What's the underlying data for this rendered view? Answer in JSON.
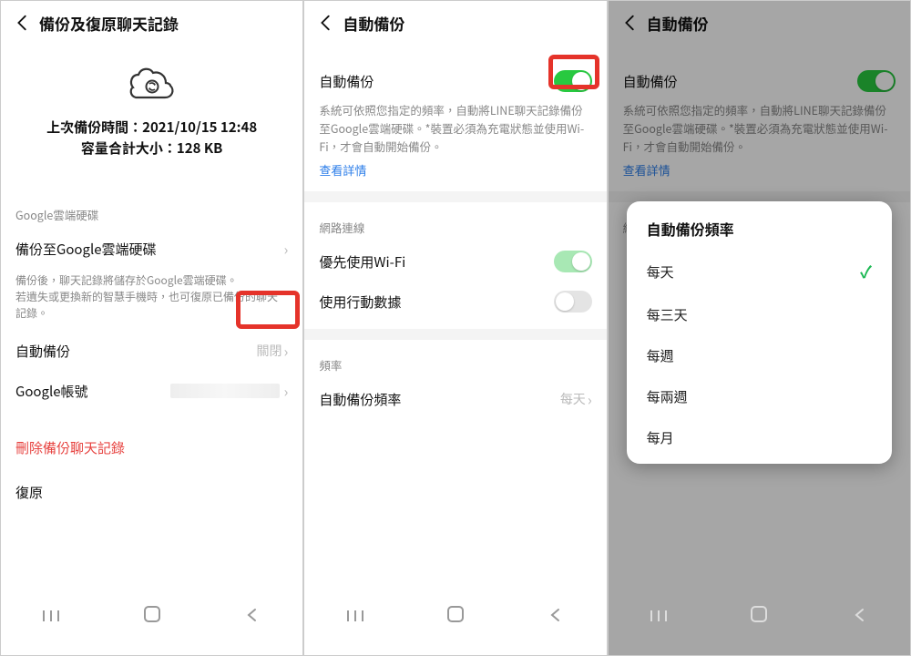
{
  "panel1": {
    "title": "備份及復原聊天記錄",
    "last_backup_label": "上次備份時間：2021/10/15 12:48",
    "size_label": "容量合計大小：128 KB",
    "cloud_section": "Google雲端硬碟",
    "backup_to_google": "備份至Google雲端硬碟",
    "backup_desc1": "備份後，聊天記錄將儲存於Google雲端硬碟。",
    "backup_desc2": "若遺失或更換新的智慧手機時，也可復原已備份的聊天記錄。",
    "auto_backup": "自動備份",
    "auto_backup_value": "關閉",
    "google_account": "Google帳號",
    "delete_backup": "刪除備份聊天記錄",
    "restore": "復原"
  },
  "panel2": {
    "title": "自動備份",
    "auto_backup": "自動備份",
    "auto_desc": "系統可依照您指定的頻率，自動將LINE聊天記錄備份至Google雲端硬碟。*裝置必須為充電狀態並使用Wi-Fi，才會自動開始備份。",
    "view_details": "查看詳情",
    "network_section": "網路連線",
    "prefer_wifi": "優先使用Wi-Fi",
    "use_mobile": "使用行動數據",
    "freq_section": "頻率",
    "freq_label": "自動備份頻率",
    "freq_value": "每天"
  },
  "panel3": {
    "title": "自動備份",
    "auto_backup": "自動備份",
    "auto_desc": "系統可依照您指定的頻率，自動將LINE聊天記錄備份至Google雲端硬碟。*裝置必須為充電狀態並使用Wi-Fi，才會自動開始備份。",
    "view_details": "查看詳情",
    "network_section": "網路連線",
    "dialog_title": "自動備份頻率",
    "options": {
      "o1": "每天",
      "o2": "每三天",
      "o3": "每週",
      "o4": "每兩週",
      "o5": "每月"
    },
    "selected": "每天"
  },
  "nav": {
    "recents": "|||",
    "home": "○",
    "back": "<"
  }
}
